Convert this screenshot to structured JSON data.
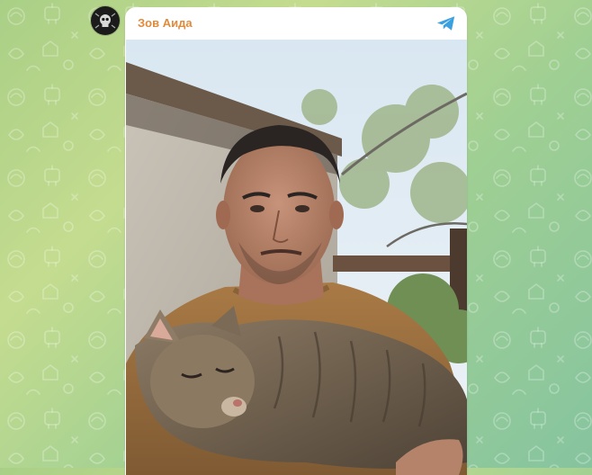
{
  "post": {
    "channel_name": "Зов Аида"
  },
  "icons": {
    "avatar": "channel-avatar",
    "share": "telegram-share-icon",
    "photo": "photo"
  },
  "colors": {
    "channel_name": "#e08a3b",
    "share_icon": "#3aa0e0",
    "wallpaper": "#a9cf86"
  }
}
